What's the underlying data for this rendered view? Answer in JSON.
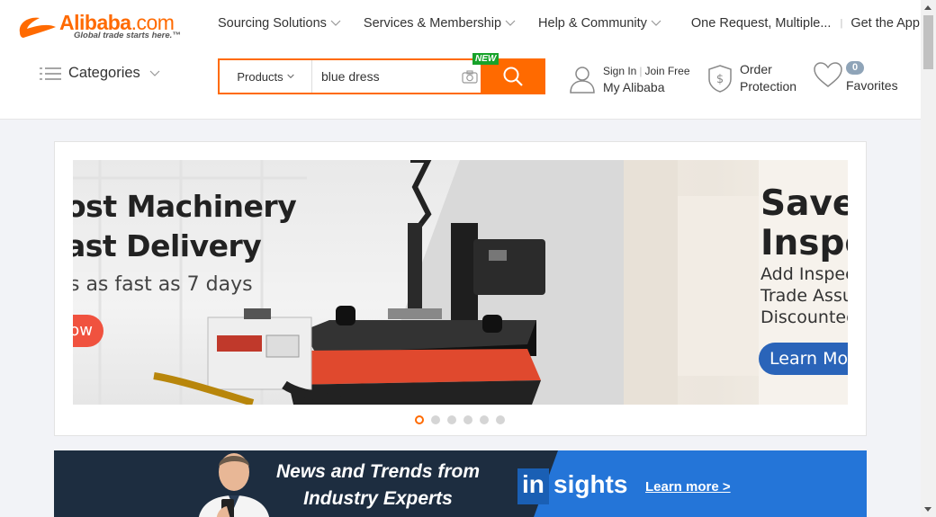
{
  "brand": {
    "name": "Alibaba",
    "name_suffix": ".com",
    "tagline": "Global trade starts here.™",
    "accent_color": "#ff6a00"
  },
  "top_nav": {
    "items": [
      {
        "label": "Sourcing Solutions",
        "icon": "chevron-down-icon"
      },
      {
        "label": "Services & Membership",
        "icon": "chevron-down-icon"
      },
      {
        "label": "Help & Community",
        "icon": "chevron-down-icon"
      }
    ],
    "one_request": "One Request, Multiple...",
    "get_app": "Get the App"
  },
  "categories": {
    "label": "Categories",
    "icon": "menu-lines-icon"
  },
  "search": {
    "scope": "Products",
    "query": "blue dress",
    "new_badge": "NEW",
    "camera_icon": "camera-icon",
    "search_icon": "search-icon"
  },
  "account": {
    "sign_in": "Sign In",
    "join_free": "Join Free",
    "my_alibaba": "My Alibaba",
    "icon": "user-icon"
  },
  "order_protection": {
    "line1": "Order",
    "line2": "Protection",
    "icon": "shield-dollar-icon"
  },
  "favorites": {
    "count": "0",
    "label": "Favorites",
    "icon": "heart-icon"
  },
  "banner": {
    "left": {
      "title_line1": "ost Machinery",
      "title_line2": "ast Delivery",
      "subtitle": "s as fast as 7 days",
      "cta": "ow"
    },
    "right": {
      "title_line1": "Save",
      "title_line2": "Inspe",
      "line1": "Add Inspec",
      "line2": "Trade Assu",
      "line3": "Discounted",
      "cta": "Learn Mor"
    },
    "dots_count": 6,
    "active_dot": 0
  },
  "insights": {
    "headline_line1": "News and Trends from",
    "headline_line2": "Industry Experts",
    "logo_in": "in",
    "logo_sights": "sights",
    "learn_more": "Learn more >"
  }
}
